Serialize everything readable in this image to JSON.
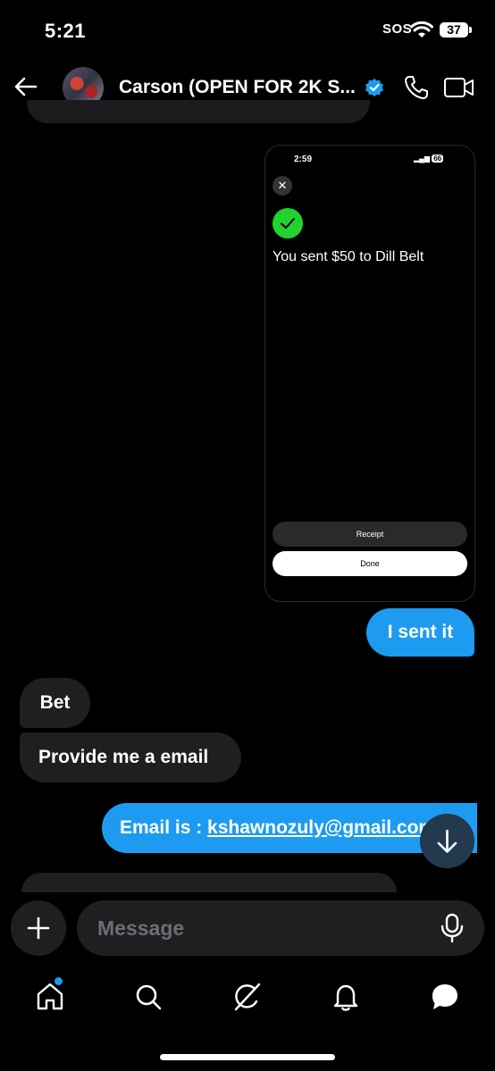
{
  "status": {
    "time": "5:21",
    "sos": "SOS",
    "battery": "37"
  },
  "header": {
    "contact_name": "Carson (OPEN FOR 2K S..."
  },
  "screenshot": {
    "time": "2:59",
    "battery": "66",
    "message": "You sent $50 to Dill Belt",
    "receipt_label": "Receipt",
    "done_label": "Done"
  },
  "messages": [
    {
      "direction": "sent",
      "text": "I sent it"
    },
    {
      "direction": "received",
      "text": "Bet"
    },
    {
      "direction": "received",
      "text": "Provide me a email"
    },
    {
      "direction": "sent",
      "prefix": "Email is : ",
      "link": "kshawnozuly@gmail.com"
    }
  ],
  "composer": {
    "placeholder": "Message"
  },
  "colors": {
    "accent": "#1d9bf0",
    "received_bubble": "#1f1f21",
    "success": "#22d22e"
  },
  "nav": [
    "home-icon",
    "search-icon",
    "grok-icon",
    "bell-icon",
    "messages-icon"
  ]
}
